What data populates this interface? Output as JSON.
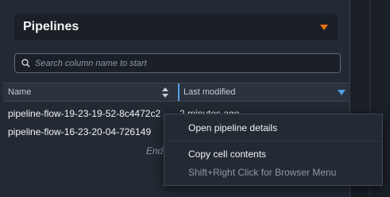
{
  "header": {
    "dropdown_label": "Pipelines"
  },
  "search": {
    "placeholder": "Search column name to start"
  },
  "table": {
    "columns": [
      "Name",
      "Last modified"
    ],
    "rows": [
      {
        "name": "pipeline-flow-19-23-19-52-8c4472c2",
        "modified": "2 minutes ago"
      },
      {
        "name": "pipeline-flow-16-23-20-04-726149",
        "modified": ""
      }
    ],
    "end_text": "End"
  },
  "context_menu": {
    "items": [
      {
        "label": "Open pipeline details",
        "enabled": true
      },
      {
        "label": "Copy cell contents",
        "enabled": true
      },
      {
        "label": "Shift+Right Click for Browser Menu",
        "enabled": false
      }
    ]
  },
  "colors": {
    "accent_orange": "#ec7211",
    "accent_blue": "#539fe5",
    "panel_bg": "#232a33"
  },
  "icons": [
    "caret-down-icon",
    "search-icon",
    "sort-icon",
    "filter-caret-icon"
  ]
}
